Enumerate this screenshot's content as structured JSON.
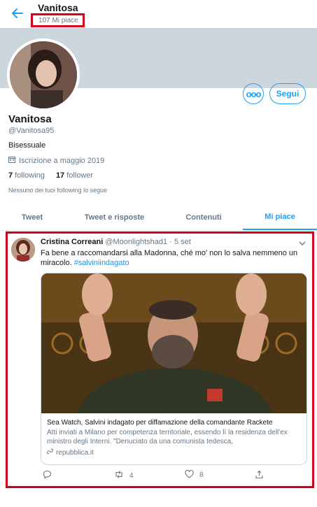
{
  "header": {
    "name": "Vanitosa",
    "likes_count": "107 Mi piace"
  },
  "profile": {
    "name": "Vanitosa",
    "handle": "@Vanitosa95",
    "bio": "Bisessuale",
    "joined": "Iscrizione a maggio 2019",
    "following_count": "7",
    "following_label": "following",
    "followers_count": "17",
    "followers_label": "follower",
    "mutual": "Nessuno dei tuoi following lo segue",
    "follow_button": "Segui",
    "more_button": "ooo"
  },
  "tabs": [
    {
      "label": "Tweet",
      "active": false
    },
    {
      "label": "Tweet e risposte",
      "active": false
    },
    {
      "label": "Contenuti",
      "active": false
    },
    {
      "label": "Mi piace",
      "active": true
    }
  ],
  "tweet": {
    "author": "Cristina Correani",
    "handle": "@Moonlightshad1",
    "separator": "·",
    "time": "5 set",
    "text": "Fa bene a raccomandarsi alla Madonna, ché mo' non lo salva nemmeno un miracolo.",
    "hashtag": "#salviniindagato",
    "card": {
      "title": "Sea Watch, Salvini indagato per diffamazione della comandante Rackete",
      "description": "Atti inviati a Milano per competenza territoriale, essendo lì la residenza dell'ex ministro degli Interni. \"Denuciato da una comunista tedesca,",
      "domain": "repubblica.it"
    },
    "reply_count": "",
    "retweet_count": "4",
    "like_count": "8"
  },
  "colors": {
    "accent": "#1da1f2",
    "highlight_border": "#d0021b",
    "muted": "#657786"
  },
  "icons": [
    "back-arrow-icon",
    "calendar-icon",
    "chevron-down-icon",
    "link-icon",
    "reply-icon",
    "retweet-icon",
    "heart-icon",
    "share-icon"
  ]
}
